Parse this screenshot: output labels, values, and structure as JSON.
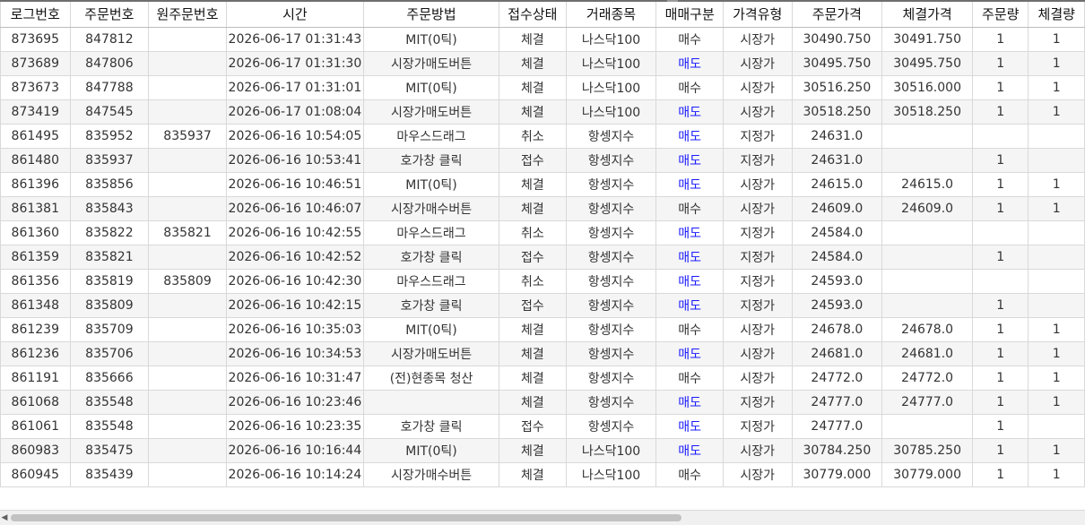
{
  "columns": [
    "로그번호",
    "주문번호",
    "원주문번호",
    "시간",
    "주문방법",
    "접수상태",
    "거래종목",
    "매매구분",
    "가격유형",
    "주문가격",
    "체결가격",
    "주문량",
    "체결량"
  ],
  "colors": {
    "sell": "#1a1aff",
    "buy": "#333333"
  },
  "rows": [
    [
      "873695",
      "847812",
      "",
      "2026-06-17 01:31:43",
      "MIT(0틱)",
      "체결",
      "나스닥100",
      "매수",
      "시장가",
      "30490.750",
      "30491.750",
      "1",
      "1"
    ],
    [
      "873689",
      "847806",
      "",
      "2026-06-17 01:31:30",
      "시장가매도버튼",
      "체결",
      "나스닥100",
      "매도",
      "시장가",
      "30495.750",
      "30495.750",
      "1",
      "1"
    ],
    [
      "873673",
      "847788",
      "",
      "2026-06-17 01:31:01",
      "MIT(0틱)",
      "체결",
      "나스닥100",
      "매수",
      "시장가",
      "30516.250",
      "30516.000",
      "1",
      "1"
    ],
    [
      "873419",
      "847545",
      "",
      "2026-06-17 01:08:04",
      "시장가매도버튼",
      "체결",
      "나스닥100",
      "매도",
      "시장가",
      "30518.250",
      "30518.250",
      "1",
      "1"
    ],
    [
      "861495",
      "835952",
      "835937",
      "2026-06-16 10:54:05",
      "마우스드래그",
      "취소",
      "항셍지수",
      "매도",
      "지정가",
      "24631.0",
      "",
      "",
      ""
    ],
    [
      "861480",
      "835937",
      "",
      "2026-06-16 10:53:41",
      "호가창 클릭",
      "접수",
      "항셍지수",
      "매도",
      "지정가",
      "24631.0",
      "",
      "1",
      ""
    ],
    [
      "861396",
      "835856",
      "",
      "2026-06-16 10:46:51",
      "MIT(0틱)",
      "체결",
      "항셍지수",
      "매도",
      "시장가",
      "24615.0",
      "24615.0",
      "1",
      "1"
    ],
    [
      "861381",
      "835843",
      "",
      "2026-06-16 10:46:07",
      "시장가매수버튼",
      "체결",
      "항셍지수",
      "매수",
      "시장가",
      "24609.0",
      "24609.0",
      "1",
      "1"
    ],
    [
      "861360",
      "835822",
      "835821",
      "2026-06-16 10:42:55",
      "마우스드래그",
      "취소",
      "항셍지수",
      "매도",
      "지정가",
      "24584.0",
      "",
      "",
      ""
    ],
    [
      "861359",
      "835821",
      "",
      "2026-06-16 10:42:52",
      "호가창 클릭",
      "접수",
      "항셍지수",
      "매도",
      "지정가",
      "24584.0",
      "",
      "1",
      ""
    ],
    [
      "861356",
      "835819",
      "835809",
      "2026-06-16 10:42:30",
      "마우스드래그",
      "취소",
      "항셍지수",
      "매도",
      "지정가",
      "24593.0",
      "",
      "",
      ""
    ],
    [
      "861348",
      "835809",
      "",
      "2026-06-16 10:42:15",
      "호가창 클릭",
      "접수",
      "항셍지수",
      "매도",
      "지정가",
      "24593.0",
      "",
      "1",
      ""
    ],
    [
      "861239",
      "835709",
      "",
      "2026-06-16 10:35:03",
      "MIT(0틱)",
      "체결",
      "항셍지수",
      "매수",
      "시장가",
      "24678.0",
      "24678.0",
      "1",
      "1"
    ],
    [
      "861236",
      "835706",
      "",
      "2026-06-16 10:34:53",
      "시장가매도버튼",
      "체결",
      "항셍지수",
      "매도",
      "시장가",
      "24681.0",
      "24681.0",
      "1",
      "1"
    ],
    [
      "861191",
      "835666",
      "",
      "2026-06-16 10:31:47",
      "(전)현종목 청산",
      "체결",
      "항셍지수",
      "매수",
      "시장가",
      "24772.0",
      "24772.0",
      "1",
      "1"
    ],
    [
      "861068",
      "835548",
      "",
      "2026-06-16 10:23:46",
      "",
      "체결",
      "항셍지수",
      "매도",
      "지정가",
      "24777.0",
      "24777.0",
      "1",
      "1"
    ],
    [
      "861061",
      "835548",
      "",
      "2026-06-16 10:23:35",
      "호가창 클릭",
      "접수",
      "항셍지수",
      "매도",
      "지정가",
      "24777.0",
      "",
      "1",
      ""
    ],
    [
      "860983",
      "835475",
      "",
      "2026-06-16 10:16:44",
      "MIT(0틱)",
      "체결",
      "나스닥100",
      "매도",
      "시장가",
      "30784.250",
      "30785.250",
      "1",
      "1"
    ],
    [
      "860945",
      "835439",
      "",
      "2026-06-16 10:14:24",
      "시장가매수버튼",
      "체결",
      "나스닥100",
      "매수",
      "시장가",
      "30779.000",
      "30779.000",
      "1",
      "1"
    ]
  ]
}
